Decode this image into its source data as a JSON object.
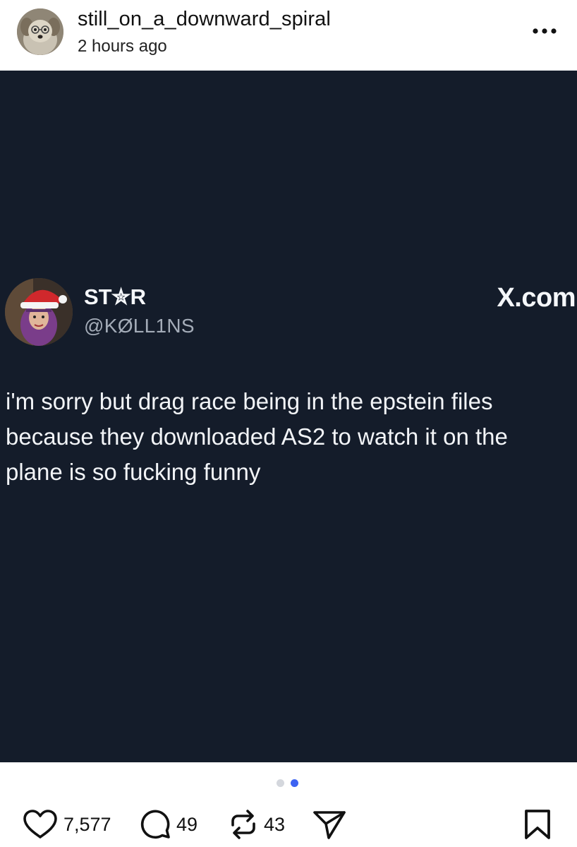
{
  "post": {
    "author_name": "still_on_a_downward_spiral",
    "timestamp": "2 hours ago",
    "more_icon": "more-horizontal-icon"
  },
  "tweet": {
    "display_name": "ST✮R",
    "handle": "@KØLL1NS",
    "source": "X.com",
    "text_lines": [
      "i'm sorry but drag race being in the epstein files",
      "because they downloaded AS2 to watch it on the",
      "plane is so fucking funny"
    ],
    "colors": {
      "background": "#141c2a",
      "text": "#f2f4f7",
      "handle": "#a4acb8"
    }
  },
  "carousel": {
    "count": 2,
    "active_index": 1,
    "active_color": "#3d63f2"
  },
  "actions": {
    "likes": "7,577",
    "comments": "49",
    "reposts": "43",
    "icons": [
      "heart-icon",
      "comment-icon",
      "repost-icon",
      "share-icon",
      "bookmark-icon"
    ]
  }
}
